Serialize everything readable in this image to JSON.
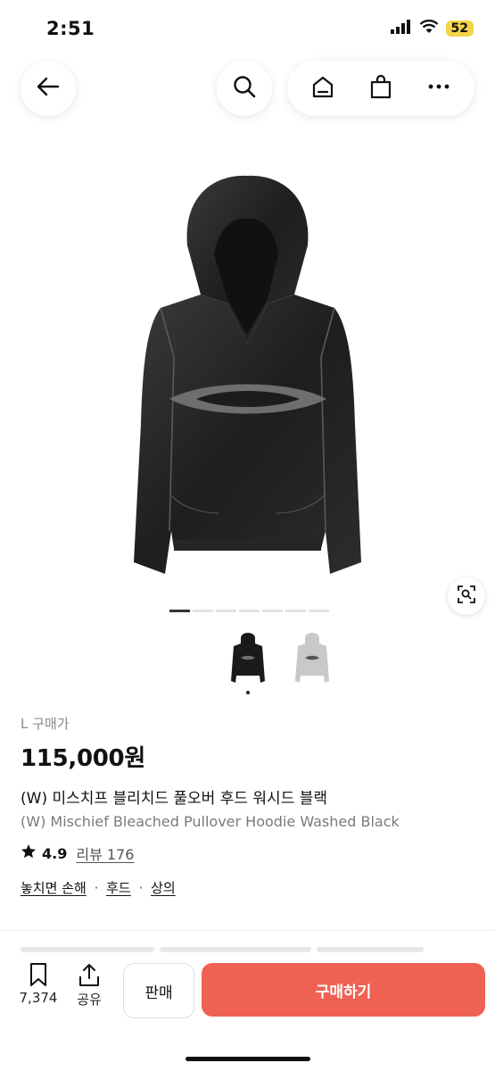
{
  "status_bar": {
    "time": "2:51",
    "battery": "52"
  },
  "product": {
    "size_label": "L",
    "buy_price_label": "구매가",
    "price": "115,000원",
    "name_ko": "(W) 미스치프 블리치드 풀오버 후드 워시드 블랙",
    "name_en": "(W) Mischief Bleached Pullover Hoodie Washed Black",
    "rating": "4.9",
    "review_label": "리뷰 176",
    "tags": [
      "놓치면 손해",
      "후드",
      "상의"
    ],
    "tag_separator": "·",
    "variant_colors": [
      "#1a1a1a",
      "#c9c9c9"
    ]
  },
  "gallery": {
    "total_images": 7,
    "active_index": 0
  },
  "bottom_bar": {
    "bookmark_count": "7,374",
    "share_label": "공유",
    "sell_label": "판매",
    "buy_label": "구매하기"
  },
  "colors": {
    "accent": "#ef6253",
    "text_primary": "#111111",
    "text_secondary": "#7a7a7a"
  }
}
